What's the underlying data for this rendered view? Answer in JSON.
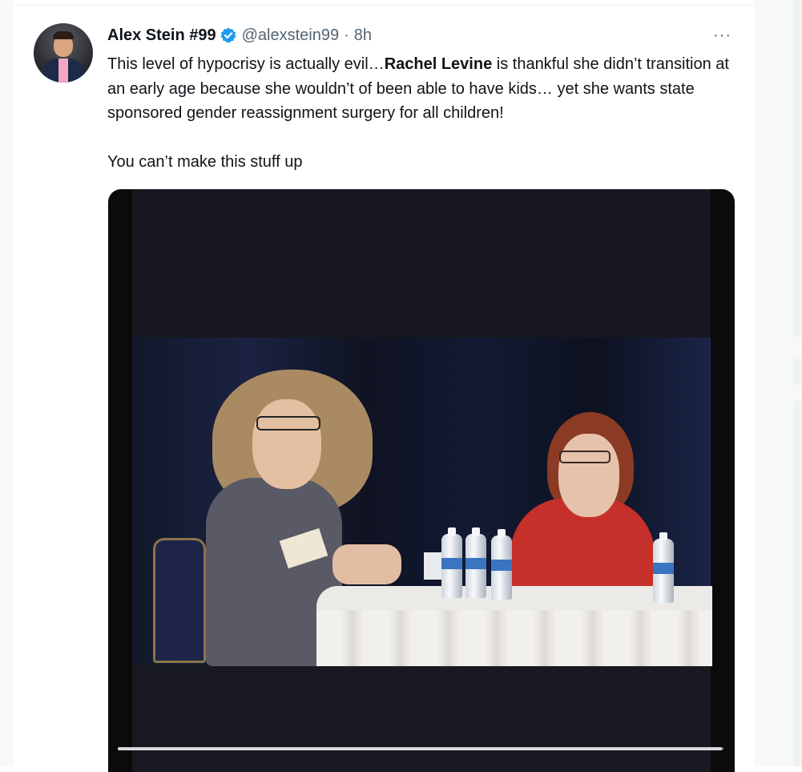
{
  "tweet": {
    "author_name": "Alex Stein #99",
    "handle": "@alexstein99",
    "separator": "·",
    "time": "8h",
    "more_label": "···",
    "text_part1": "This level of hypocrisy is actually evil…",
    "text_bold": "Rachel Levine",
    "text_part2": " is thankful she didn’t transition at an early age because she wouldn’t of been able to have kids… yet she wants state sponsored gender reassignment surgery for all children!",
    "text_paragraph2": "You can’t make this stuff up"
  },
  "colors": {
    "verified_blue": "#1d9bf0",
    "secondary_text": "#536471",
    "primary_text": "#0f1419"
  },
  "video": {
    "progress_fraction": 0.998
  }
}
